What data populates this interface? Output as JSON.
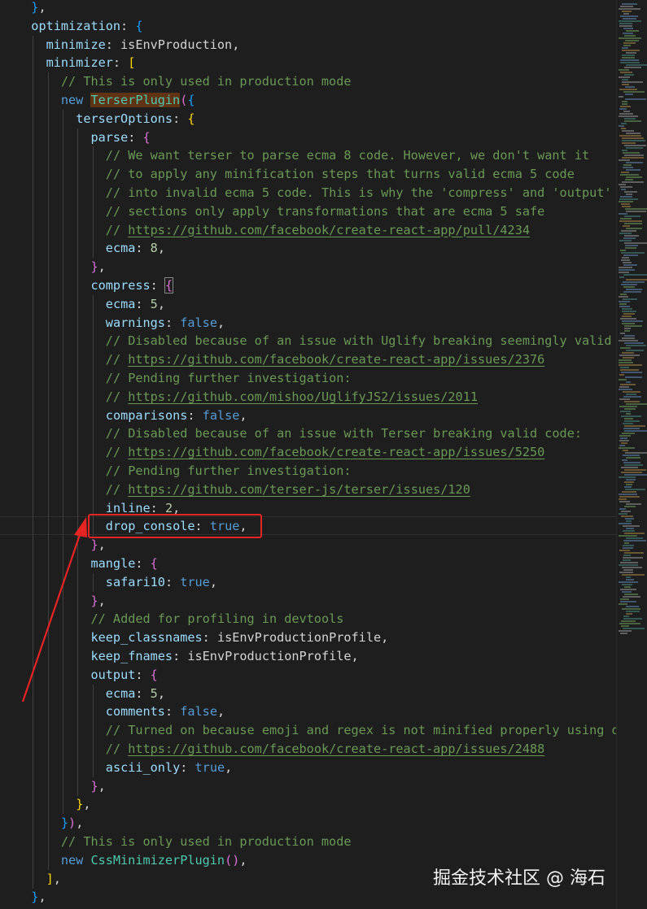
{
  "code_lines": [
    {
      "indent": 1,
      "tokens": [
        [
          "b3",
          "}"
        ],
        [
          "pl",
          ","
        ]
      ]
    },
    {
      "indent": 1,
      "tokens": [
        [
          "prop",
          "optimization"
        ],
        [
          "pl",
          ": "
        ],
        [
          "b3",
          "{"
        ]
      ]
    },
    {
      "indent": 2,
      "tokens": [
        [
          "prop",
          "minimize"
        ],
        [
          "pl",
          ": isEnvProduction,"
        ]
      ]
    },
    {
      "indent": 2,
      "tokens": [
        [
          "prop",
          "minimizer"
        ],
        [
          "pl",
          ": "
        ],
        [
          "b1",
          "["
        ]
      ]
    },
    {
      "indent": 3,
      "tokens": [
        [
          "com",
          "// This is only used in production mode"
        ]
      ]
    },
    {
      "indent": 3,
      "tokens": [
        [
          "kw",
          "new "
        ],
        [
          "cls",
          "TerserPlugin"
        ],
        [
          "b2",
          "("
        ],
        [
          "b3",
          "{"
        ]
      ]
    },
    {
      "indent": 4,
      "tokens": [
        [
          "prop",
          "terserOptions"
        ],
        [
          "pl",
          ": "
        ],
        [
          "b1",
          "{"
        ]
      ]
    },
    {
      "indent": 5,
      "tokens": [
        [
          "prop",
          "parse"
        ],
        [
          "pl",
          ": "
        ],
        [
          "b2",
          "{"
        ]
      ]
    },
    {
      "indent": 6,
      "tokens": [
        [
          "com",
          "// We want terser to parse ecma 8 code. However, we don't want it"
        ]
      ]
    },
    {
      "indent": 6,
      "tokens": [
        [
          "com",
          "// to apply any minification steps that turns valid ecma 5 code"
        ]
      ]
    },
    {
      "indent": 6,
      "tokens": [
        [
          "com",
          "// into invalid ecma 5 code. This is why the 'compress' and 'output'"
        ]
      ]
    },
    {
      "indent": 6,
      "tokens": [
        [
          "com",
          "// sections only apply transformations that are ecma 5 safe"
        ]
      ]
    },
    {
      "indent": 6,
      "tokens": [
        [
          "com",
          "// "
        ],
        [
          "url",
          "https://github.com/facebook/create-react-app/pull/4234"
        ]
      ]
    },
    {
      "indent": 6,
      "tokens": [
        [
          "prop",
          "ecma"
        ],
        [
          "pl",
          ": "
        ],
        [
          "num",
          "8"
        ],
        [
          "pl",
          ","
        ]
      ]
    },
    {
      "indent": 5,
      "tokens": [
        [
          "b2",
          "}"
        ],
        [
          "pl",
          ","
        ]
      ]
    },
    {
      "indent": 5,
      "tokens": [
        [
          "prop",
          "compress"
        ],
        [
          "pl",
          ": "
        ],
        [
          "b2",
          "{"
        ]
      ]
    },
    {
      "indent": 6,
      "tokens": [
        [
          "prop",
          "ecma"
        ],
        [
          "pl",
          ": "
        ],
        [
          "num",
          "5"
        ],
        [
          "pl",
          ","
        ]
      ]
    },
    {
      "indent": 6,
      "tokens": [
        [
          "prop",
          "warnings"
        ],
        [
          "pl",
          ": "
        ],
        [
          "kw",
          "false"
        ],
        [
          "pl",
          ","
        ]
      ]
    },
    {
      "indent": 6,
      "tokens": [
        [
          "com",
          "// Disabled because of an issue with Uglify breaking seemingly valid code:"
        ]
      ]
    },
    {
      "indent": 6,
      "tokens": [
        [
          "com",
          "// "
        ],
        [
          "url",
          "https://github.com/facebook/create-react-app/issues/2376"
        ]
      ]
    },
    {
      "indent": 6,
      "tokens": [
        [
          "com",
          "// Pending further investigation:"
        ]
      ]
    },
    {
      "indent": 6,
      "tokens": [
        [
          "com",
          "// "
        ],
        [
          "url",
          "https://github.com/mishoo/UglifyJS2/issues/2011"
        ]
      ]
    },
    {
      "indent": 6,
      "tokens": [
        [
          "prop",
          "comparisons"
        ],
        [
          "pl",
          ": "
        ],
        [
          "kw",
          "false"
        ],
        [
          "pl",
          ","
        ]
      ]
    },
    {
      "indent": 6,
      "tokens": [
        [
          "com",
          "// Disabled because of an issue with Terser breaking valid code:"
        ]
      ]
    },
    {
      "indent": 6,
      "tokens": [
        [
          "com",
          "// "
        ],
        [
          "url",
          "https://github.com/facebook/create-react-app/issues/5250"
        ]
      ]
    },
    {
      "indent": 6,
      "tokens": [
        [
          "com",
          "// Pending further investigation:"
        ]
      ]
    },
    {
      "indent": 6,
      "tokens": [
        [
          "com",
          "// "
        ],
        [
          "url",
          "https://github.com/terser-js/terser/issues/120"
        ]
      ]
    },
    {
      "indent": 6,
      "tokens": [
        [
          "prop",
          "inline"
        ],
        [
          "pl",
          ": "
        ],
        [
          "num",
          "2"
        ],
        [
          "pl",
          ","
        ]
      ]
    },
    {
      "indent": 6,
      "tokens": [
        [
          "prop",
          "drop_console"
        ],
        [
          "pl",
          ": "
        ],
        [
          "kw",
          "true"
        ],
        [
          "pl",
          ","
        ]
      ]
    },
    {
      "indent": 5,
      "tokens": [
        [
          "b2",
          "}"
        ],
        [
          "pl",
          ","
        ]
      ]
    },
    {
      "indent": 5,
      "tokens": [
        [
          "prop",
          "mangle"
        ],
        [
          "pl",
          ": "
        ],
        [
          "b2",
          "{"
        ]
      ]
    },
    {
      "indent": 6,
      "tokens": [
        [
          "prop",
          "safari10"
        ],
        [
          "pl",
          ": "
        ],
        [
          "kw",
          "true"
        ],
        [
          "pl",
          ","
        ]
      ]
    },
    {
      "indent": 5,
      "tokens": [
        [
          "b2",
          "}"
        ],
        [
          "pl",
          ","
        ]
      ]
    },
    {
      "indent": 5,
      "tokens": [
        [
          "com",
          "// Added for profiling in devtools"
        ]
      ]
    },
    {
      "indent": 5,
      "tokens": [
        [
          "prop",
          "keep_classnames"
        ],
        [
          "pl",
          ": isEnvProductionProfile,"
        ]
      ]
    },
    {
      "indent": 5,
      "tokens": [
        [
          "prop",
          "keep_fnames"
        ],
        [
          "pl",
          ": isEnvProductionProfile,"
        ]
      ]
    },
    {
      "indent": 5,
      "tokens": [
        [
          "prop",
          "output"
        ],
        [
          "pl",
          ": "
        ],
        [
          "b2",
          "{"
        ]
      ]
    },
    {
      "indent": 6,
      "tokens": [
        [
          "prop",
          "ecma"
        ],
        [
          "pl",
          ": "
        ],
        [
          "num",
          "5"
        ],
        [
          "pl",
          ","
        ]
      ]
    },
    {
      "indent": 6,
      "tokens": [
        [
          "prop",
          "comments"
        ],
        [
          "pl",
          ": "
        ],
        [
          "kw",
          "false"
        ],
        [
          "pl",
          ","
        ]
      ]
    },
    {
      "indent": 6,
      "tokens": [
        [
          "com",
          "// Turned on because emoji and regex is not minified properly using default"
        ]
      ]
    },
    {
      "indent": 6,
      "tokens": [
        [
          "com",
          "// "
        ],
        [
          "url",
          "https://github.com/facebook/create-react-app/issues/2488"
        ]
      ]
    },
    {
      "indent": 6,
      "tokens": [
        [
          "prop",
          "ascii_only"
        ],
        [
          "pl",
          ": "
        ],
        [
          "kw",
          "true"
        ],
        [
          "pl",
          ","
        ]
      ]
    },
    {
      "indent": 5,
      "tokens": [
        [
          "b2",
          "}"
        ],
        [
          "pl",
          ","
        ]
      ]
    },
    {
      "indent": 4,
      "tokens": [
        [
          "b1",
          "}"
        ],
        [
          "pl",
          ","
        ]
      ]
    },
    {
      "indent": 3,
      "tokens": [
        [
          "b3",
          "}"
        ],
        [
          "b2",
          ")"
        ],
        [
          "pl",
          ","
        ]
      ]
    },
    {
      "indent": 3,
      "tokens": [
        [
          "com",
          "// This is only used in production mode"
        ]
      ]
    },
    {
      "indent": 3,
      "tokens": [
        [
          "kw",
          "new "
        ],
        [
          "cls",
          "CssMinimizerPlugin"
        ],
        [
          "b2",
          "()"
        ],
        [
          "pl",
          ","
        ]
      ]
    },
    {
      "indent": 2,
      "tokens": [
        [
          "b1",
          "]"
        ],
        [
          "pl",
          ","
        ]
      ]
    },
    {
      "indent": 1,
      "tokens": [
        [
          "b3",
          "}"
        ],
        [
          "pl",
          ","
        ]
      ]
    }
  ],
  "highlighted_word": "TerserPlugin",
  "highlighted_key": "drop_console",
  "colors": {
    "background": "#1e1e1e",
    "property": "#9cdcfe",
    "keyword": "#569cd6",
    "class": "#4ec9b0",
    "number": "#b5cea8",
    "comment": "#6a9955",
    "annotation": "#e52424"
  },
  "watermark": "掘金技术社区 @ 海石"
}
